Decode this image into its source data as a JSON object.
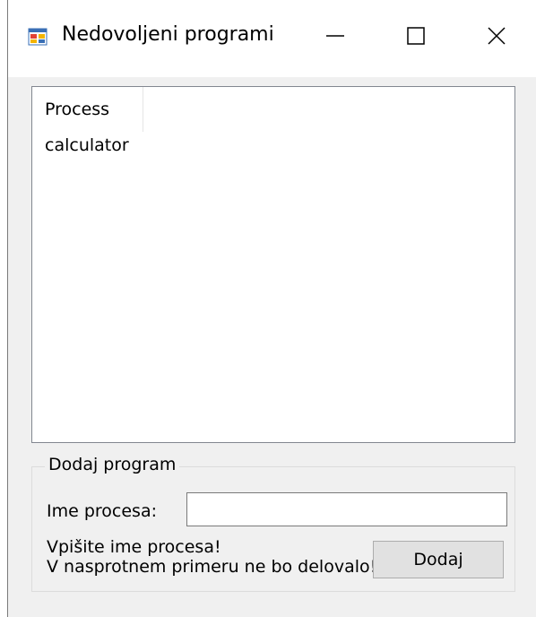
{
  "window": {
    "title": "Nedovoljeni programi"
  },
  "icons": {
    "app": "app-window-icon",
    "minimize": "minimize-icon",
    "maximize": "maximize-icon",
    "close": "close-icon"
  },
  "process_list": {
    "column_header": "Process",
    "rows": [
      "calculator"
    ]
  },
  "add_group": {
    "legend": "Dodaj program",
    "name_label": "Ime procesa:",
    "name_value": "",
    "hint_line1": "Vpišite ime procesa!",
    "hint_line2": "V nasprotnem primeru ne bo delovalo!",
    "add_button": "Dodaj"
  }
}
